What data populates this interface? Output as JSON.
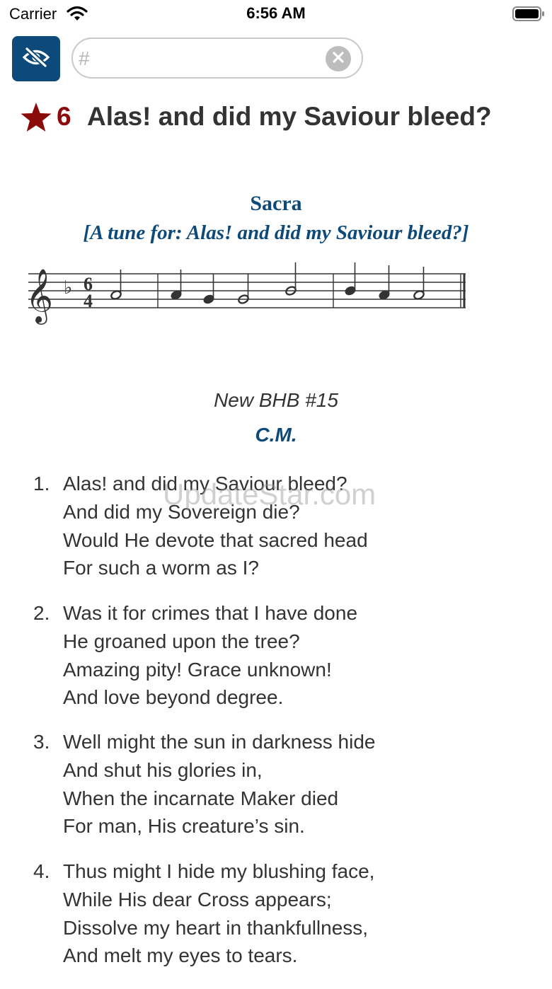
{
  "status_bar": {
    "carrier": "Carrier",
    "time": "6:56 AM"
  },
  "search": {
    "placeholder": "#",
    "value": ""
  },
  "hymn": {
    "number": "6",
    "title": "Alas! and did my Saviour bleed?",
    "tune_name": "Sacra",
    "tune_for": "[A tune for: Alas! and did my Saviour bleed?]",
    "source": "New BHB #15",
    "meter": "C.M.",
    "favorite_color": "#8b0a0a",
    "accent_color": "#0d4a7a"
  },
  "verses": [
    {
      "number": "1.",
      "lines": [
        "Alas! and did my Saviour bleed?",
        "And did my Sovereign die?",
        "Would He devote that sacred head",
        "For such a worm as I?"
      ]
    },
    {
      "number": "2.",
      "lines": [
        "Was it for crimes that I have done",
        "He groaned upon the tree?",
        "Amazing pity! Grace unknown!",
        "And love beyond degree."
      ]
    },
    {
      "number": "3.",
      "lines": [
        "Well might the sun in darkness hide",
        "And shut his glories in,",
        "When the incarnate Maker died",
        "For man, His creature’s sin."
      ]
    },
    {
      "number": "4.",
      "lines": [
        "Thus might I hide my blushing face,",
        "While His dear Cross appears;",
        "Dissolve my heart in thankfullness,",
        "And melt my eyes to tears."
      ]
    }
  ],
  "watermark": "UpdateStar.com",
  "icons": {
    "status": [
      "wifi-icon",
      "battery-icon"
    ],
    "toolbar": [
      "eye-slash-icon",
      "clear-icon"
    ],
    "title": "star-icon"
  }
}
